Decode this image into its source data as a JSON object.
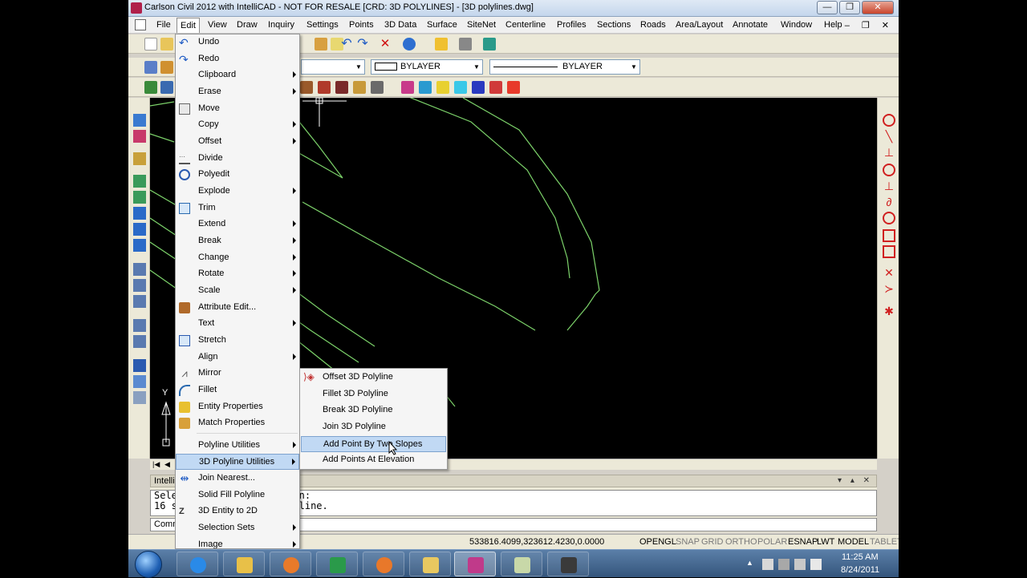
{
  "window": {
    "title": "Carlson Civil 2012 with IntelliCAD - NOT FOR RESALE [CRD: 3D POLYLINES] - [3D polylines.dwg]",
    "minimize": "—",
    "maximize": "❐",
    "close": "✕"
  },
  "menubar": {
    "items": [
      "File",
      "Edit",
      "View",
      "Draw",
      "Inquiry",
      "Settings",
      "Points",
      "3D Data",
      "Surface",
      "SiteNet",
      "Centerline",
      "Profiles",
      "Sections",
      "Roads",
      "Area/Layout",
      "Annotate",
      "Window",
      "Help"
    ],
    "active": "Edit",
    "mdi_controls": "– ❐ ✕"
  },
  "toolbar": {
    "color_combo": "BYLAYER",
    "linetype_combo": "BYLAYER"
  },
  "edit_menu": {
    "items": [
      {
        "label": "Undo",
        "submenu": false,
        "icon": "undo-icon"
      },
      {
        "label": "Redo",
        "submenu": false,
        "icon": "redo-icon"
      },
      {
        "label": "Clipboard",
        "submenu": true,
        "icon": ""
      },
      {
        "label": "Erase",
        "submenu": true,
        "icon": ""
      },
      {
        "label": "Move",
        "submenu": false,
        "icon": "move-icon"
      },
      {
        "label": "Copy",
        "submenu": true,
        "icon": ""
      },
      {
        "label": "Offset",
        "submenu": true,
        "icon": ""
      },
      {
        "label": "Divide",
        "submenu": false,
        "icon": "divide-icon"
      },
      {
        "label": "Polyedit",
        "submenu": false,
        "icon": "polyedit-icon"
      },
      {
        "label": "Explode",
        "submenu": true,
        "icon": ""
      },
      {
        "label": "Trim",
        "submenu": false,
        "icon": "trim-icon"
      },
      {
        "label": "Extend",
        "submenu": true,
        "icon": ""
      },
      {
        "label": "Break",
        "submenu": true,
        "icon": ""
      },
      {
        "label": "Change",
        "submenu": true,
        "icon": ""
      },
      {
        "label": "Rotate",
        "submenu": true,
        "icon": ""
      },
      {
        "label": "Scale",
        "submenu": true,
        "icon": ""
      },
      {
        "label": "Attribute Edit...",
        "submenu": false,
        "icon": "attribute-edit-icon"
      },
      {
        "label": "Text",
        "submenu": true,
        "icon": ""
      },
      {
        "label": "Stretch",
        "submenu": false,
        "icon": "stretch-icon"
      },
      {
        "label": "Align",
        "submenu": true,
        "icon": ""
      },
      {
        "label": "Mirror",
        "submenu": false,
        "icon": "mirror-icon"
      },
      {
        "label": "Fillet",
        "submenu": false,
        "icon": "fillet-icon"
      },
      {
        "label": "Entity Properties",
        "submenu": false,
        "icon": "entity-properties-icon"
      },
      {
        "label": "Match Properties",
        "submenu": false,
        "icon": "match-properties-icon"
      },
      {
        "label": "Polyline Utilities",
        "submenu": true,
        "icon": ""
      },
      {
        "label": "3D Polyline Utilities",
        "submenu": true,
        "icon": ""
      },
      {
        "label": "Join Nearest...",
        "submenu": false,
        "icon": "join-nearest-icon"
      },
      {
        "label": "Solid Fill Polyline",
        "submenu": false,
        "icon": ""
      },
      {
        "label": "3D Entity to 2D",
        "submenu": false,
        "icon": "entity-to-2d-icon"
      },
      {
        "label": "Selection Sets",
        "submenu": true,
        "icon": ""
      },
      {
        "label": "Image",
        "submenu": true,
        "icon": ""
      }
    ],
    "highlighted": "3D Polyline Utilities"
  },
  "submenu_3d_polyline": {
    "items": [
      "Offset 3D Polyline",
      "Fillet 3D Polyline",
      "Break 3D Polyline",
      "Join 3D Polyline",
      "Add Point By Two Slopes",
      "Add Points At Elevation"
    ],
    "highlighted": "Add Point By Two Slopes"
  },
  "canvas": {
    "ucs_y_label": "Y"
  },
  "command_panel": {
    "title": "IntelliCAD Prompt History",
    "lines": [
      "Select 3D polyline to join:",
      "16 segments in first polyline."
    ],
    "input_label": "Command:"
  },
  "statusbar": {
    "coords": "533816.4099,323612.4230,0.0000",
    "toggles": [
      {
        "label": "OPENGL",
        "on": true
      },
      {
        "label": "SNAP",
        "on": false
      },
      {
        "label": "GRID",
        "on": false
      },
      {
        "label": "ORTHO",
        "on": false
      },
      {
        "label": "POLAR",
        "on": false
      },
      {
        "label": "ESNAP",
        "on": true
      },
      {
        "label": "LWT",
        "on": true
      },
      {
        "label": "MODEL",
        "on": true
      },
      {
        "label": "TABLET",
        "on": false
      }
    ]
  },
  "taskbar": {
    "time": "11:25 AM",
    "date": "8/24/2011",
    "tray_expand": "▲"
  },
  "colors": {
    "drawing_lines": "#7cd26a",
    "menu_highlight": "#c1d9f4",
    "canvas_bg": "#000000"
  }
}
